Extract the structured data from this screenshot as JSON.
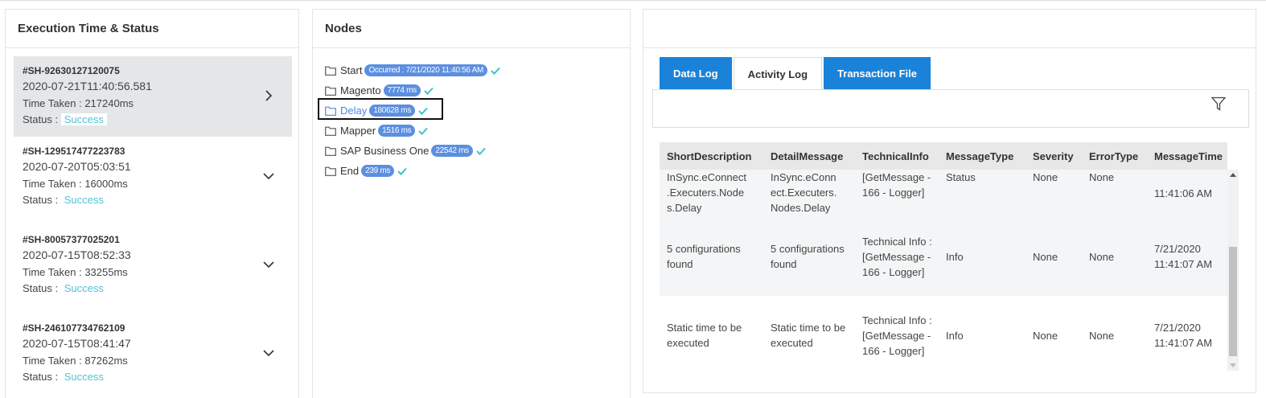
{
  "exec_panel": {
    "title": "Execution Time & Status",
    "items": [
      {
        "id": "#SH-92630127120075",
        "date": "2020-07-21T11:40:56.581",
        "time_label": "Time Taken : ",
        "time": "217240ms",
        "status_label": "Status : ",
        "status": "Success",
        "chevron": "chevron-right-icon"
      },
      {
        "id": "#SH-129517477223783",
        "date": "2020-07-20T05:03:51",
        "time_label": "Time Taken : ",
        "time": "16000ms",
        "status_label": "Status : ",
        "status": "Success",
        "chevron": "chevron-down-icon"
      },
      {
        "id": "#SH-80057377025201",
        "date": "2020-07-15T08:52:33",
        "time_label": "Time Taken : ",
        "time": "33255ms",
        "status_label": "Status : ",
        "status": "Success",
        "chevron": "chevron-down-icon"
      },
      {
        "id": "#SH-246107734762109",
        "date": "2020-07-15T08:41:47",
        "time_label": "Time Taken : ",
        "time": "87262ms",
        "status_label": "Status : ",
        "status": "Success",
        "chevron": "chevron-down-icon"
      }
    ]
  },
  "nodes_panel": {
    "title": "Nodes",
    "nodes": [
      {
        "label": "Start",
        "badge": "Occurred : 7/21/2020 11:40:56 AM"
      },
      {
        "label": "Magento",
        "badge": "7774 ms"
      },
      {
        "label": "Delay",
        "badge": "180628 ms"
      },
      {
        "label": "Mapper",
        "badge": "1516 ms"
      },
      {
        "label": "SAP Business One",
        "badge": "22542 ms"
      },
      {
        "label": "End",
        "badge": "239 ms"
      }
    ]
  },
  "log_panel": {
    "tabs": [
      "Data Log",
      "Activity Log",
      "Transaction File"
    ],
    "columns": [
      "ShortDescription",
      "DetailMessage",
      "TechnicalInfo",
      "MessageType",
      "Severity",
      "ErrorType",
      "MessageTime"
    ],
    "rows": [
      [
        "InSync.eConnect .Executers.Node s.Delay",
        "InSync.eConn ect.Executers. Nodes.Delay",
        "[GetMessage - 166 - Logger]",
        "Status",
        "None",
        "None",
        "11:41:06 AM"
      ],
      [
        "5 configurations found",
        "5 configurations found",
        "Technical Info : [GetMessage - 166 - Logger]",
        "Info",
        "None",
        "None",
        "7/21/2020 11:41:07 AM"
      ],
      [
        "Static time to be executed",
        "Static time to be executed",
        "Technical Info : [GetMessage - 166 - Logger]",
        "Info",
        "None",
        "None",
        "7/21/2020 11:41:07 AM"
      ]
    ]
  },
  "colors": {
    "accent_blue": "#1a82d8",
    "badge_blue": "#5b8fe0",
    "success_teal": "#4fc3d6",
    "check_teal": "#3cc3c9"
  }
}
